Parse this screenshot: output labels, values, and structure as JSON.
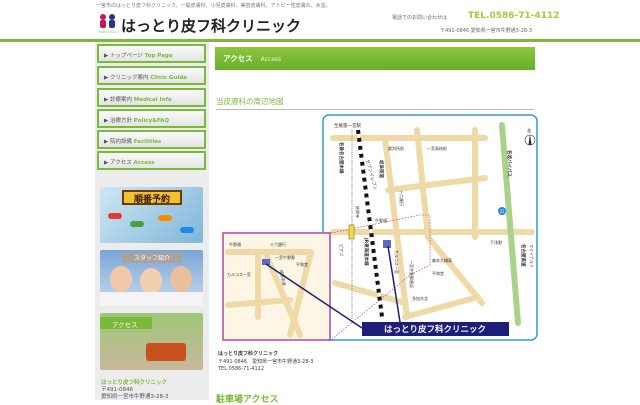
{
  "header": {
    "tagline": "一宮市のはっとり皮フ科クリニック。一般皮膚科、小児皮膚科、美容皮膚科、アトピー性皮膚炎、水虫。",
    "logo_text": "はっとり皮フ科クリニック",
    "contact_label": "電話でのお問い合わせは",
    "tel": "TEL.0586-71-4112",
    "address": "〒491-0846 愛知県一宮市牛野通3-28-3"
  },
  "nav": [
    {
      "jp": "トップページ",
      "en": "Top Page"
    },
    {
      "jp": "クリニック案内",
      "en": "Clinic Guide"
    },
    {
      "jp": "診療案内",
      "en": "Medical Info"
    },
    {
      "jp": "治療方針",
      "en": "Policy&FAQ"
    },
    {
      "jp": "院内設備",
      "en": "Facilities"
    },
    {
      "jp": "アクセス",
      "en": "Access"
    }
  ],
  "banners": {
    "reservation": "順番予約",
    "staff": "スタッフ紹介",
    "access": "アクセス"
  },
  "sidebar_info": {
    "name": "はっとり皮フ科クリニック",
    "zip": "〒491-0846",
    "address": "愛知県一宮市牛野通3-28-3"
  },
  "main": {
    "title": "アクセス",
    "title_en": "Access",
    "section": "当皮膚科の周辺地図",
    "parking": "駐車場アクセス"
  },
  "info": {
    "name": "はっとり皮フ科クリニック",
    "address": "〒491-0846　愛知県一宮市牛野通3-28-3",
    "tel": "TEL.0586-71-4112"
  },
  "map": {
    "station": "至尾張一宮駅",
    "meitetsu": "名鉄名古屋本線",
    "seven": "セブンイレブン",
    "gifu": "岐阜街道",
    "court": "裁判所前",
    "school": "一宮高校前",
    "bypass": "名岐バイパス",
    "bank": "十六銀行",
    "ushino": "牛野通",
    "morimoto": "森本大橋東",
    "shimoasano": "下浅野",
    "mcd": "マクドナルド",
    "expressway": "名古屋高速",
    "myokoji": "妙興寺",
    "piago": "ピアゴ",
    "jr": "JR東海道本線",
    "kalcos": "カルコス一宮",
    "post": "一宮牛野郵便局",
    "heiwado": "平和堂",
    "takagi": "多加木北",
    "north": "北",
    "route": "22",
    "clinic": "はっとり皮フ科クリニック",
    "inset_post": "一宮牛野郵",
    "inset_kalcos": "カルコス一宮"
  },
  "colors": {
    "accent": "#7cb83a",
    "navy": "#1c1f7a"
  }
}
